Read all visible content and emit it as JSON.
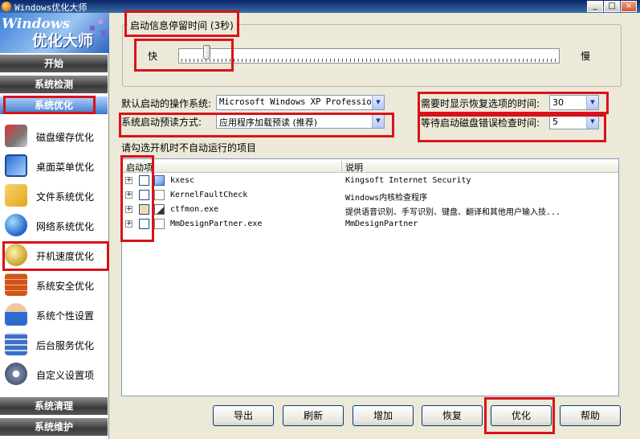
{
  "window": {
    "title": "Windows优化大师",
    "minimize": "_",
    "maximize": "□",
    "close": "×"
  },
  "sidebar": {
    "logo_line1": "Windows",
    "logo_line2": "优化大师",
    "sections": {
      "start": "开始",
      "detect": "系统检测",
      "optimize": "系统优化",
      "clean": "系统清理",
      "maintain": "系统维护"
    },
    "items": [
      {
        "label": "磁盘缓存优化",
        "icon": "disk-cache-icon"
      },
      {
        "label": "桌面菜单优化",
        "icon": "desktop-menu-icon"
      },
      {
        "label": "文件系统优化",
        "icon": "file-system-icon"
      },
      {
        "label": "网络系统优化",
        "icon": "network-globe-icon"
      },
      {
        "label": "开机速度优化",
        "icon": "boot-speed-icon"
      },
      {
        "label": "系统安全优化",
        "icon": "firewall-icon"
      },
      {
        "label": "系统个性设置",
        "icon": "users-icon"
      },
      {
        "label": "后台服务优化",
        "icon": "server-icon"
      },
      {
        "label": "自定义设置项",
        "icon": "gears-icon"
      }
    ]
  },
  "main": {
    "splash_group_title": "启动信息停留时间 (3秒)",
    "fast_label": "快",
    "slow_label": "慢",
    "slider_value": 3,
    "default_os_label": "默认启动的操作系统:",
    "default_os_value": "Microsoft Windows XP Professions",
    "prefetch_label": "系统启动预读方式:",
    "prefetch_value": "应用程序加载预读 (推荐)",
    "recovery_label": "需要时显示恢复选项的时间:",
    "recovery_value": "30",
    "chkdsk_label": "等待启动磁盘错误检查时间:",
    "chkdsk_value": "5",
    "list_caption": "请勾选开机时不自动运行的项目",
    "list_headers": {
      "startup": "启动项",
      "description": "说明"
    },
    "rows": [
      {
        "name": "kxesc",
        "desc": "Kingsoft Internet Security",
        "icon": "shield-check-icon",
        "checked": false
      },
      {
        "name": "KernelFaultCheck",
        "desc": "Windows内核检查程序",
        "icon": "blank-doc-icon",
        "checked": false
      },
      {
        "name": "ctfmon.exe",
        "desc": "提供语音识别、手写识别、键盘、翻译和其他用户输入技...",
        "icon": "pen-doc-icon",
        "checked": false
      },
      {
        "name": "MmDesignPartner.exe",
        "desc": "MmDesignPartner",
        "icon": "blank-doc-icon",
        "checked": false
      }
    ],
    "buttons": {
      "export": "导出",
      "refresh": "刷新",
      "add": "增加",
      "restore": "恢复",
      "optimize": "优化",
      "help": "帮助"
    }
  },
  "colors": {
    "highlight_box": "#d8121a",
    "title_bar": "#0a246a",
    "sidebar_active": "#3a79c8"
  }
}
